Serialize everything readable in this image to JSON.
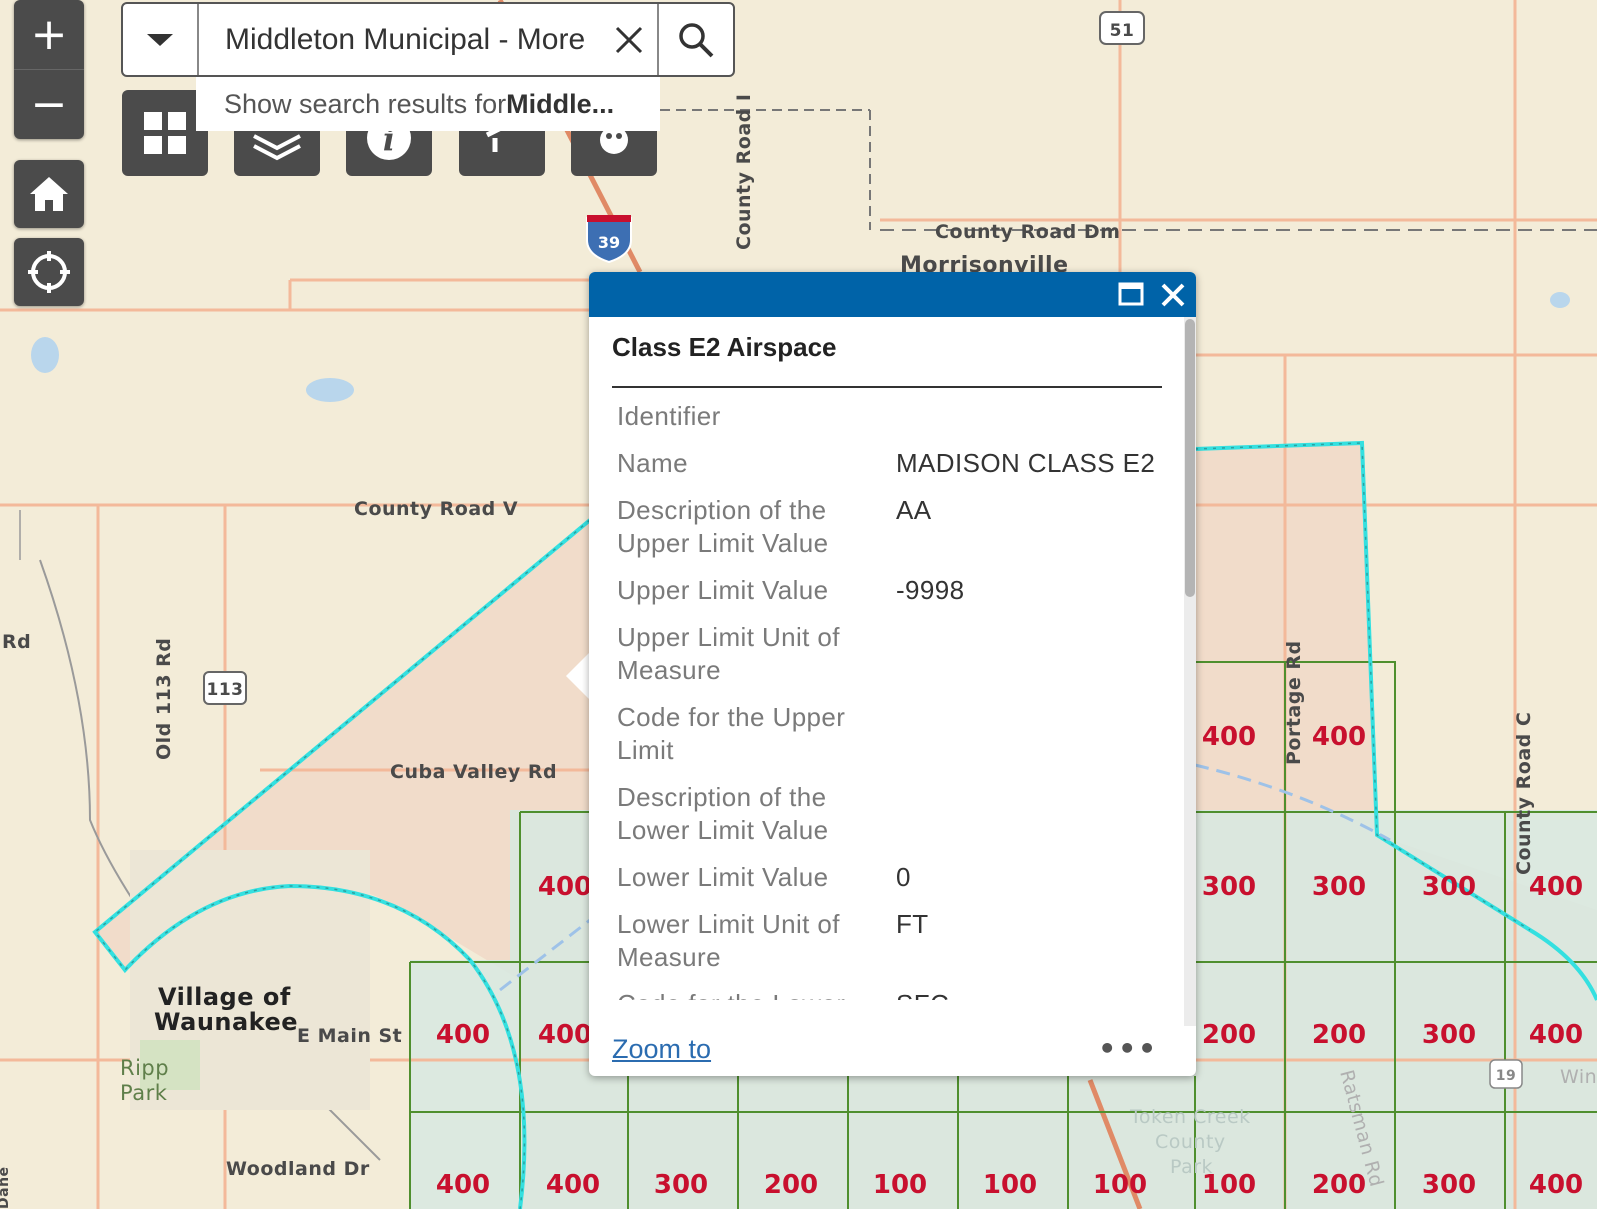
{
  "search": {
    "value": "Middleton Municipal - More",
    "suggestion_prefix": "Show search results for ",
    "suggestion_term": "Middle..."
  },
  "controls": {
    "zoom_in": "+",
    "zoom_out": "−"
  },
  "map_labels": {
    "hwy_51": "51",
    "hwy_39": "39",
    "hwy_113": "113",
    "hwy_19": "19",
    "county_road_dm": "County Road Dm",
    "morrisonville": "Morrisonville",
    "county_road_i": "County Road I",
    "county_road_v": "County Road V",
    "rd_left": "Rd",
    "old_113_rd": "Old 113 Rd",
    "cuba_valley_rd": "Cuba Valley Rd",
    "village_line1": "Village of",
    "village_line2": "Waunakee",
    "e_main_st": "E Main St",
    "ripp_line1": "Ripp",
    "ripp_line2": "Park",
    "woodland_dr": "Woodland Dr",
    "portage_rd": "Portage Rd",
    "county_road_c": "County Road C",
    "token_line1": "Token Creek",
    "token_line2": "County",
    "token_line3": "Park",
    "ratsman_rd": "Ratsman Rd",
    "win": "Win",
    "edge_label": "Dane"
  },
  "grid_labels": [
    "400",
    "400",
    "400",
    "300",
    "300",
    "300",
    "400",
    "400",
    "400",
    "400",
    "200",
    "200",
    "300",
    "400",
    "400",
    "400",
    "300",
    "200",
    "100",
    "100",
    "100",
    "100",
    "200",
    "300",
    "400"
  ],
  "popup": {
    "title": "Class E2 Airspace",
    "fields": [
      {
        "key": "Identifier",
        "value": ""
      },
      {
        "key": "Name",
        "value": "MADISON CLASS E2"
      },
      {
        "key": "Description of the Upper Limit Value",
        "value": "AA"
      },
      {
        "key": "Upper Limit Value",
        "value": "-9998"
      },
      {
        "key": "Upper Limit Unit of Measure",
        "value": ""
      },
      {
        "key": "Code for the Upper Limit",
        "value": ""
      },
      {
        "key": "Description of the Lower Limit Value",
        "value": ""
      },
      {
        "key": "Lower Limit Value",
        "value": "0"
      },
      {
        "key": "Lower Limit Unit of Measure",
        "value": "FT"
      },
      {
        "key": "Code for the Lower",
        "value": "SFC"
      }
    ],
    "zoom_to": "Zoom to",
    "more": "•••"
  },
  "colors": {
    "basemap": "#f3ecd8",
    "road": "#f3b99a",
    "airspace_outline": "#34e0e0",
    "grid": "#4f8f2e",
    "grid_label": "#c8102e",
    "popup_header": "#0063a8"
  }
}
